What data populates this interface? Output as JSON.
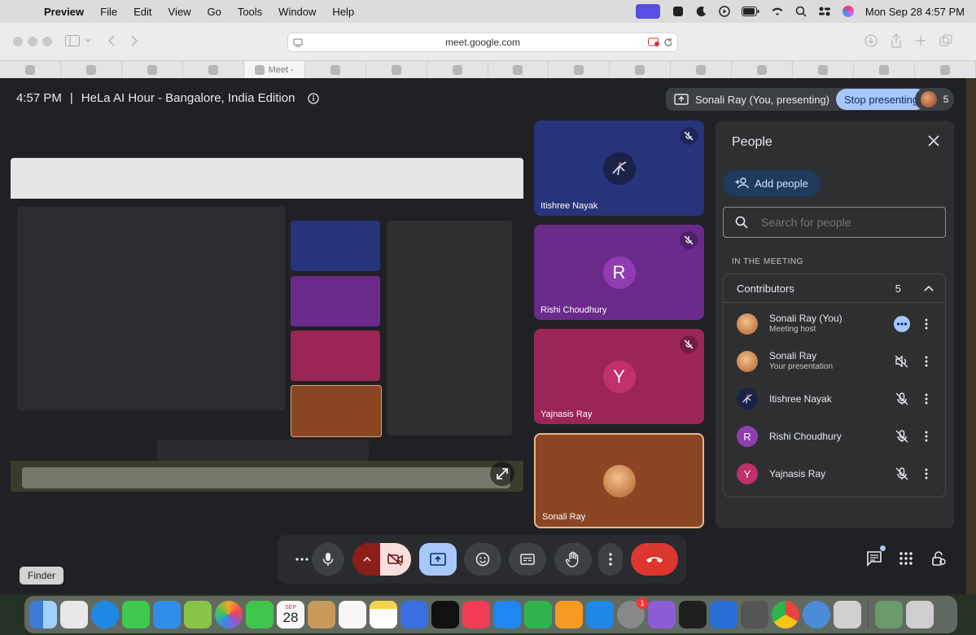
{
  "menubar": {
    "apple": "",
    "items": [
      "Preview",
      "File",
      "Edit",
      "View",
      "Go",
      "Tools",
      "Window",
      "Help"
    ],
    "clock": "Mon Sep 28  4:57 PM"
  },
  "browser": {
    "url": "meet.google.com",
    "active_tab": "Meet -"
  },
  "meet": {
    "time": "4:57 PM",
    "separator": "|",
    "meeting_title": "HeLa AI Hour - Bangalore, India Edition",
    "presenting_text": "Sonali Ray (You, presenting)",
    "stop_presenting": "Stop presenting",
    "participant_count": "5"
  },
  "tiles": [
    {
      "name": "Itishree Nayak",
      "initial": "",
      "color": "#27337a"
    },
    {
      "name": "Rishi Choudhury",
      "initial": "R",
      "color": "#6a2a8a"
    },
    {
      "name": "Yajnasis Ray",
      "initial": "Y",
      "color": "#9a2556"
    },
    {
      "name": "Sonali Ray",
      "initial": "",
      "color": "#8a4522"
    }
  ],
  "people_panel": {
    "title": "People",
    "add_people": "Add people",
    "search_placeholder": "Search for people",
    "section": "IN THE MEETING",
    "group": "Contributors",
    "group_count": "5",
    "participants": [
      {
        "name": "Sonali Ray (You)",
        "sub": "Meeting host",
        "initial": "",
        "color": "#b96a3a"
      },
      {
        "name": "Sonali Ray",
        "sub": "Your presentation",
        "initial": "",
        "color": "#b96a3a"
      },
      {
        "name": "Itishree Nayak",
        "sub": "",
        "initial": "",
        "color": "#2a3570"
      },
      {
        "name": "Rishi Choudhury",
        "sub": "",
        "initial": "R",
        "color": "#8f3db0"
      },
      {
        "name": "Yajnasis Ray",
        "sub": "",
        "initial": "Y",
        "color": "#c0306a"
      }
    ]
  },
  "dock": {
    "tooltip": "Finder",
    "calendar_month": "SEP",
    "calendar_day": "28",
    "settings_badge": "1",
    "colors": [
      "#3d7bd9",
      "#e8e8e8",
      "#1e88e5",
      "#3fc94e",
      "#2f8fe8",
      "#f4f4f4",
      "#f5a623",
      "#41c44a",
      "#f2f2f2",
      "#c79a5b",
      "#f7f7f7",
      "#f5d34a",
      "#3a6fe0",
      "#111111",
      "#f23b55",
      "#1e87f0",
      "#2fb34d",
      "#f59a23",
      "#1e88e5",
      "#888888",
      "#8b5cd6",
      "#1f1f1f",
      "#2a6fd6",
      "#555555",
      "#e8453c",
      "#4b8bd8",
      "#d0d0d0",
      "#6b9a6b",
      "#cfcfcf"
    ]
  }
}
